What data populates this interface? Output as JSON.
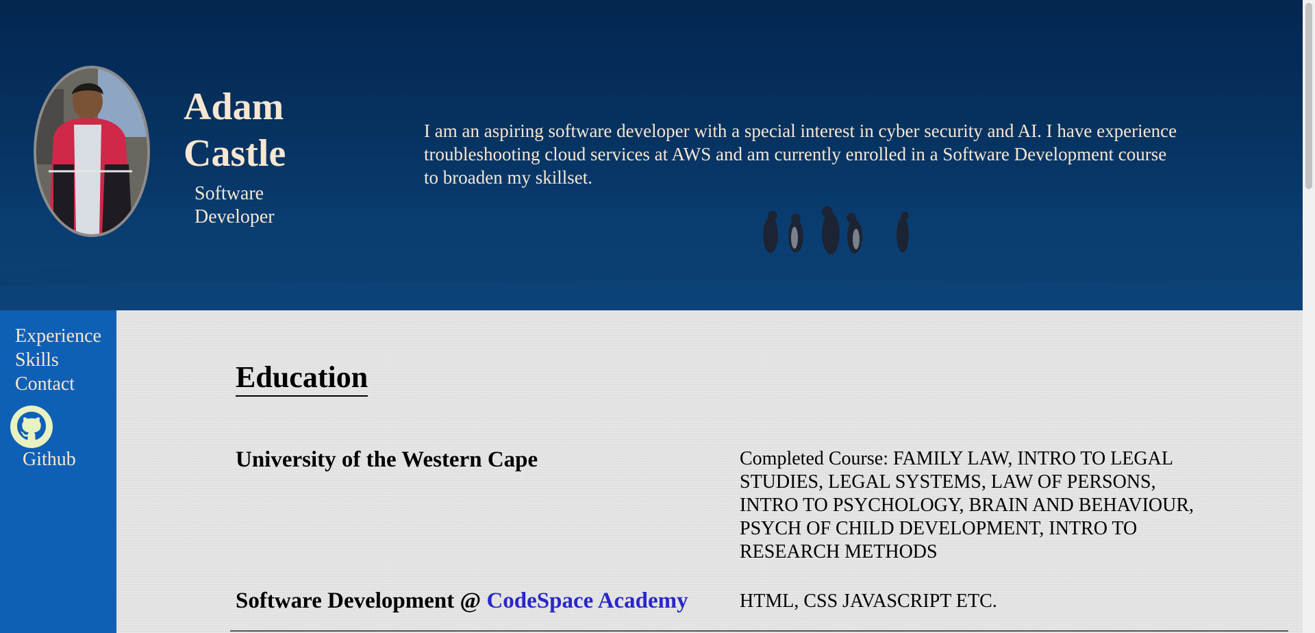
{
  "header": {
    "name": "Adam Castle",
    "role": "Software Developer",
    "bio": "I am an aspiring software developer with a special interest in cyber security and AI. I have experience troubleshooting cloud services at AWS and am currently enrolled in a Software Development course to broaden my skillset."
  },
  "sidebar": {
    "items": [
      {
        "label": "Experience"
      },
      {
        "label": "Skills"
      },
      {
        "label": "Contact"
      }
    ],
    "github_label": "Github"
  },
  "main": {
    "section_title": "Education",
    "education": [
      {
        "school": "University of the Western Cape",
        "description": "Completed Course: FAMILY LAW, INTRO TO LEGAL STUDIES, LEGAL SYSTEMS, LAW OF PERSONS, INTRO TO PSYCHOLOGY, BRAIN AND BEHAVIOUR, PSYCH OF CHILD DEVELOPMENT, INTRO TO RESEARCH METHODS"
      },
      {
        "school_prefix": "Software Development @ ",
        "school_link": "CodeSpace Academy",
        "description": "HTML, CSS JAVASCRIPT ETC."
      }
    ]
  },
  "colors": {
    "header_bg": "#073666",
    "sidebar_bg": "#0e60b6",
    "header_text": "#f7e7d2",
    "link": "#2a27c8"
  }
}
